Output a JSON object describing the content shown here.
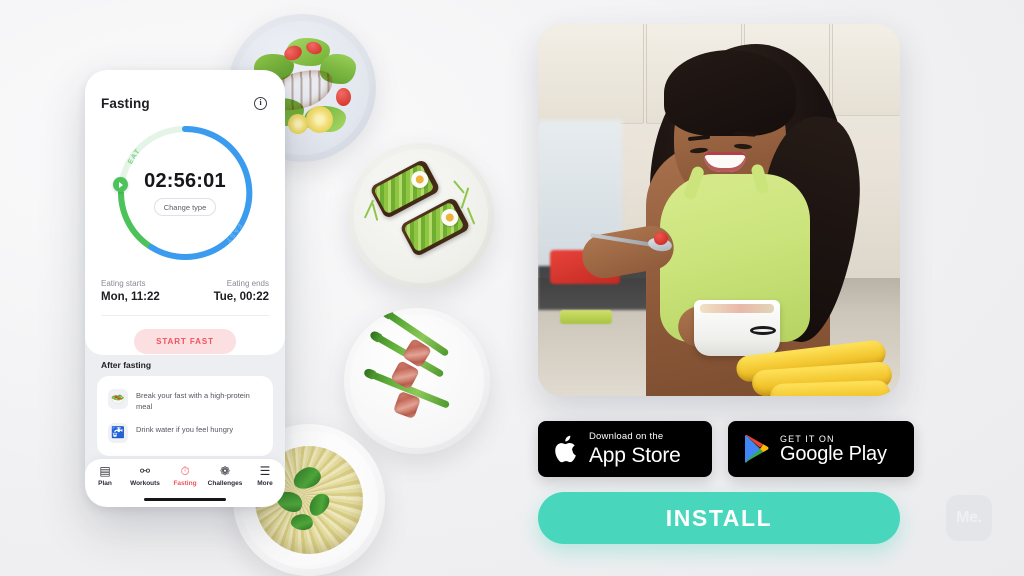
{
  "background_color": "#f1f1f3",
  "phone": {
    "fasting_card": {
      "title": "Fasting",
      "info_icon": "info-icon",
      "timer": "02:56:01",
      "change_type_label": "Change type",
      "ring": {
        "eat_label": "EAT",
        "fast_label": "FAST",
        "eat_color": "#4cc35a",
        "fast_color": "#3b9bee",
        "track_color": "#e8f6ea"
      },
      "eating_starts_label": "Eating starts",
      "eating_starts_value": "Mon, 11:22",
      "eating_ends_label": "Eating ends",
      "eating_ends_value": "Tue, 00:22",
      "start_fast_label": "START FAST",
      "start_fast_bg": "#fbdfe1",
      "start_fast_color": "#f0545d"
    },
    "after_fasting": {
      "title": "After fasting",
      "tips": [
        {
          "icon": "salad-bowl-icon",
          "glyph": "🥗",
          "text": "Break your fast with a high-protein meal"
        },
        {
          "icon": "water-tap-icon",
          "glyph": "🚰",
          "text": "Drink water if you feel hungry"
        }
      ]
    },
    "tabbar": [
      {
        "name": "plan",
        "glyph": "▤",
        "label": "Plan",
        "active": false
      },
      {
        "name": "workouts",
        "glyph": "⚯",
        "label": "Workouts",
        "active": false
      },
      {
        "name": "fasting",
        "glyph": "⏱",
        "label": "Fasting",
        "active": true
      },
      {
        "name": "challenges",
        "glyph": "❁",
        "label": "Challenges",
        "active": false
      },
      {
        "name": "more",
        "glyph": "☰",
        "label": "More",
        "active": false
      }
    ],
    "active_tab_color": "#f0545d"
  },
  "food_photos": [
    {
      "name": "grilled-salmon-salad-plate",
      "alt": "Grilled salmon on green salad with cherry tomatoes and lemon"
    },
    {
      "name": "avocado-toast-plate",
      "alt": "Two rye avocado toasts topped with sliced boiled egg"
    },
    {
      "name": "bacon-wrapped-asparagus-plate",
      "alt": "Bacon wrapped asparagus spears on a white plate"
    },
    {
      "name": "pesto-pasta-plate",
      "alt": "Pesto spaghetti with fresh basil leaves"
    }
  ],
  "hero": {
    "name": "hero-photo",
    "alt": "Smiling woman in a lime green sports bra eating fruit from a white bowl in a kitchen with bananas on the counter"
  },
  "store_badges": [
    {
      "name": "app-store-badge",
      "icon": "apple-icon",
      "small": "Download on the",
      "big": "App Store"
    },
    {
      "name": "google-play-badge",
      "icon": "google-play-icon",
      "small": "GET IT ON",
      "big": "Google Play"
    }
  ],
  "install": {
    "label": "INSTALL",
    "color": "#48d6bd"
  },
  "watermark": {
    "label": "Me."
  }
}
